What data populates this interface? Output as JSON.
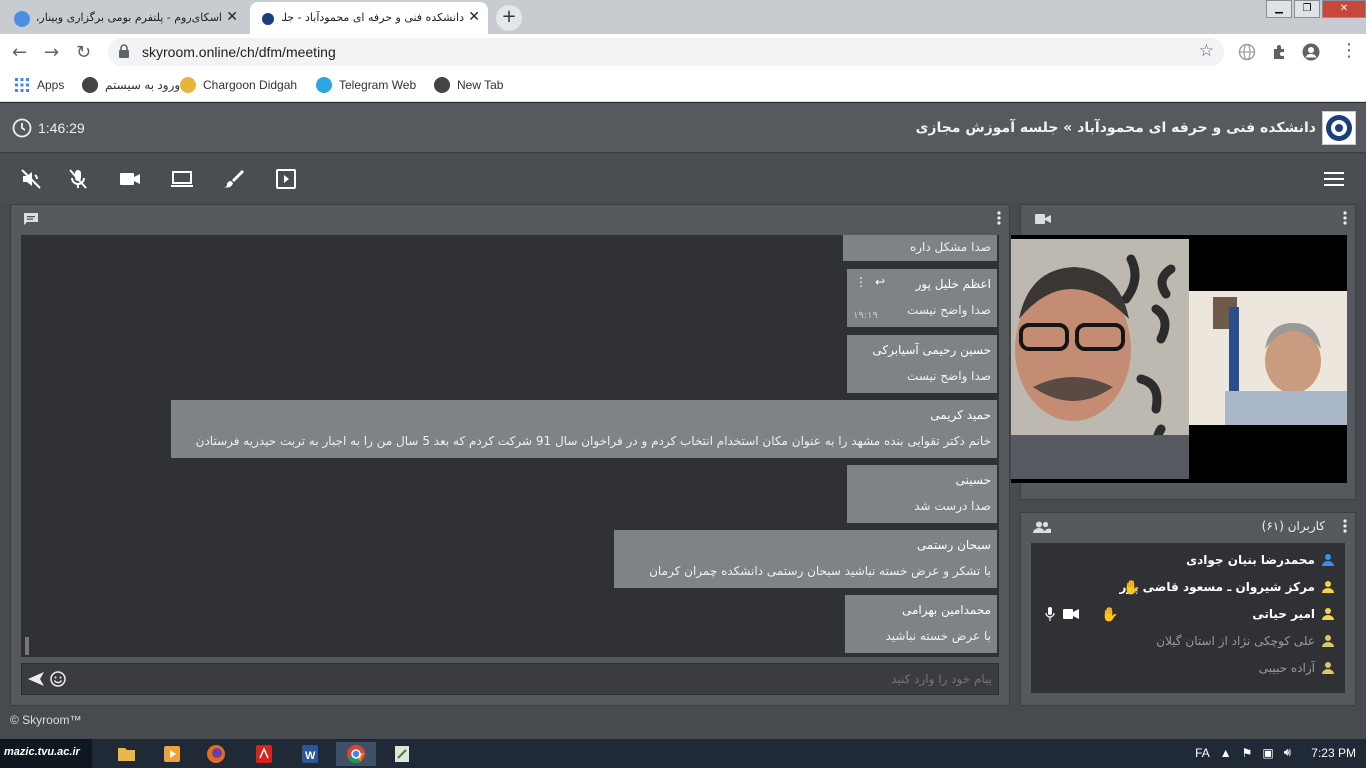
{
  "browser": {
    "tabs": [
      {
        "title": "اسکای‌روم - پلتفرم بومی برگزاری وبینار، آ",
        "active": false
      },
      {
        "title": "دانشکده فنی و حرفه ای محمودآباد - جلسه آ",
        "active": true
      }
    ],
    "new_tab": "+",
    "close_glyph": "✕",
    "url": "skyroom.online/ch/dfm/meeting",
    "bookmarks": [
      "Apps",
      "ورود به سیستم",
      "Chargoon Didgah",
      "Telegram Web",
      "New Tab"
    ]
  },
  "header": {
    "timer": "1:46:29",
    "title": "دانشکده فنی و حرفه ای محمودآباد » جلسه آموزش مجازی"
  },
  "chat": {
    "messages": [
      {
        "sender": "",
        "text": "صدا مشکل داره",
        "time": ""
      },
      {
        "sender": "اعظم خلیل پور",
        "text": "صدا واضح نیست",
        "time": "۱۹:۱۹"
      },
      {
        "sender": "حسین رحیمی آسیابرکی",
        "text": "صدا واضح نیست",
        "time": ""
      },
      {
        "sender": "حمید کریمی",
        "text": "خانم دکتر تقوایی بنده مشهد را به عنوان مکان استخدام انتخاب کردم و در فراخوان سال 91 شرکت کردم که بعد 5 سال من را به اجبار به تربت حیدریه فرستادن",
        "time": ""
      },
      {
        "sender": "حسینی",
        "text": "صدا درست شد",
        "time": ""
      },
      {
        "sender": "سبحان رستمی",
        "text": "با تشکر و عرض خسته نباشید سبحان رستمی دانشکده چمران کرمان",
        "time": ""
      },
      {
        "sender": "محمدامین بهرامی",
        "text": "با عرض خسته نباشید",
        "time": ""
      }
    ],
    "input_placeholder": "پیام خود را وارد کنید"
  },
  "users": {
    "title": "کاربران (۶۱)",
    "list": [
      {
        "name": "محمدرضا بنیان جوادی",
        "icon_color": "#3d8ef0",
        "dim": false
      },
      {
        "name": "مرکز شیروان ـ مسعود قاضی پور",
        "icon_color": "#f3d54a",
        "dim": false
      },
      {
        "name": "امیر حیاتی",
        "icon_color": "#f3d54a",
        "dim": false
      },
      {
        "name": "علی کوچکی نژاد از استان گیلان",
        "icon_color": "#d8c76a",
        "dim": true
      },
      {
        "name": "آزاده حبیبی",
        "icon_color": "#d8c76a",
        "dim": true
      }
    ]
  },
  "footer": "© Skyroom™",
  "taskbar": {
    "badge": "mazic.tvu.ac.ir",
    "lang": "FA",
    "clock": "7:23 PM"
  },
  "colors": {
    "accent": "#3d8ef0",
    "hand": "#f3d54a",
    "bubble": "#7f8286"
  }
}
